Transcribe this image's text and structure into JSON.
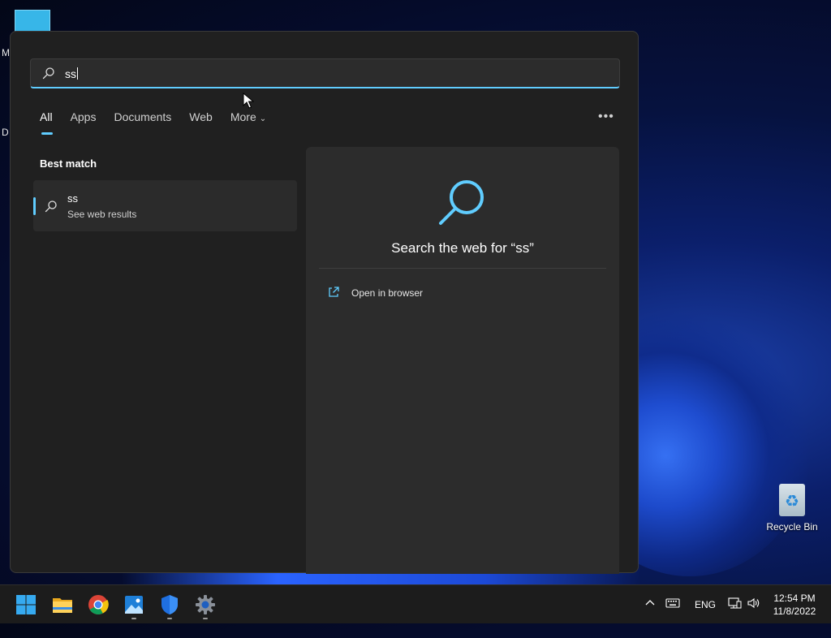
{
  "desktop": {
    "left_letters": [
      "M",
      "D"
    ],
    "recycle_bin_label": "Recycle Bin"
  },
  "search": {
    "query": "ss",
    "tabs": [
      {
        "label": "All",
        "active": true
      },
      {
        "label": "Apps"
      },
      {
        "label": "Documents"
      },
      {
        "label": "Web"
      },
      {
        "label": "More",
        "has_dropdown": true
      }
    ],
    "more_options_icon": "ellipsis-icon",
    "best_match_title": "Best match",
    "best_match": {
      "title": "ss",
      "subtitle": "See web results",
      "icon": "search-icon"
    },
    "preview": {
      "title": "Search the web for “ss”",
      "action_label": "Open in browser",
      "action_icon": "open-external-icon"
    }
  },
  "taskbar": {
    "apps": [
      {
        "name": "start",
        "icon": "windows-logo-icon"
      },
      {
        "name": "file-explorer",
        "icon": "folder-icon"
      },
      {
        "name": "chrome",
        "icon": "chrome-icon"
      },
      {
        "name": "photos",
        "icon": "photos-icon",
        "running": true
      },
      {
        "name": "windows-security",
        "icon": "shield-icon",
        "running": true
      },
      {
        "name": "settings",
        "icon": "gear-icon",
        "running": true
      }
    ],
    "tray": {
      "language": "ENG",
      "icons": [
        "chevron-up-icon",
        "keyboard-icon",
        "network-icon",
        "volume-icon"
      ]
    },
    "time": "12:54 PM",
    "date": "11/8/2022"
  },
  "colors": {
    "accent": "#60cdff",
    "panel_bg": "#202020",
    "taskbar_bg": "#1c1c1c"
  }
}
